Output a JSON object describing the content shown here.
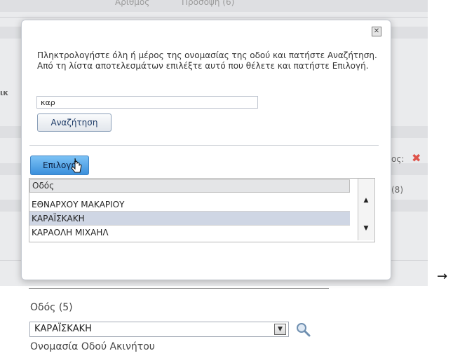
{
  "background": {
    "col_numbers": "Αριθμός",
    "col_facade": "Πρόσοψη (6)",
    "left_fragment": "ικ",
    "right_label": "ος:",
    "right_count": "(8)"
  },
  "dialog": {
    "close_icon": "close-x-icon",
    "instruction": "Πληκτρολογήστε όλη ή μέρος της ονομασίας της οδού και πατήστε Αναζήτηση. Από τη λίστα αποτελεσμάτων επιλέξτε αυτό που θέλετε και πατήστε Επιλογή.",
    "search_value": "καρ",
    "search_button": "Αναζήτηση",
    "select_button": "Επιλογή",
    "list_header": "Οδός",
    "rows": [
      "ΕΘΝΑΡΧΟΥ ΜΑΚΑΡΙΟΥ",
      "ΚΑΡΑΪΣΚΑΚΗ",
      "ΚΑΡΑΟΛΗ ΜΙΧΑΗΛ"
    ],
    "selected_row": "ΚΑΡΑΪΣΚΑΚΗ"
  },
  "arrow": "→",
  "result": {
    "field_label": "Οδός (5)",
    "combo_value": "ΚΑΡΑΪΣΚΑΚΗ",
    "search_icon": "magnifier-icon",
    "next_label": "Ονομασία Οδού Ακινήτου"
  },
  "colors": {
    "accent": "#3a8fdc",
    "selected_row": "#cfd6e4",
    "danger": "#d9362b"
  }
}
